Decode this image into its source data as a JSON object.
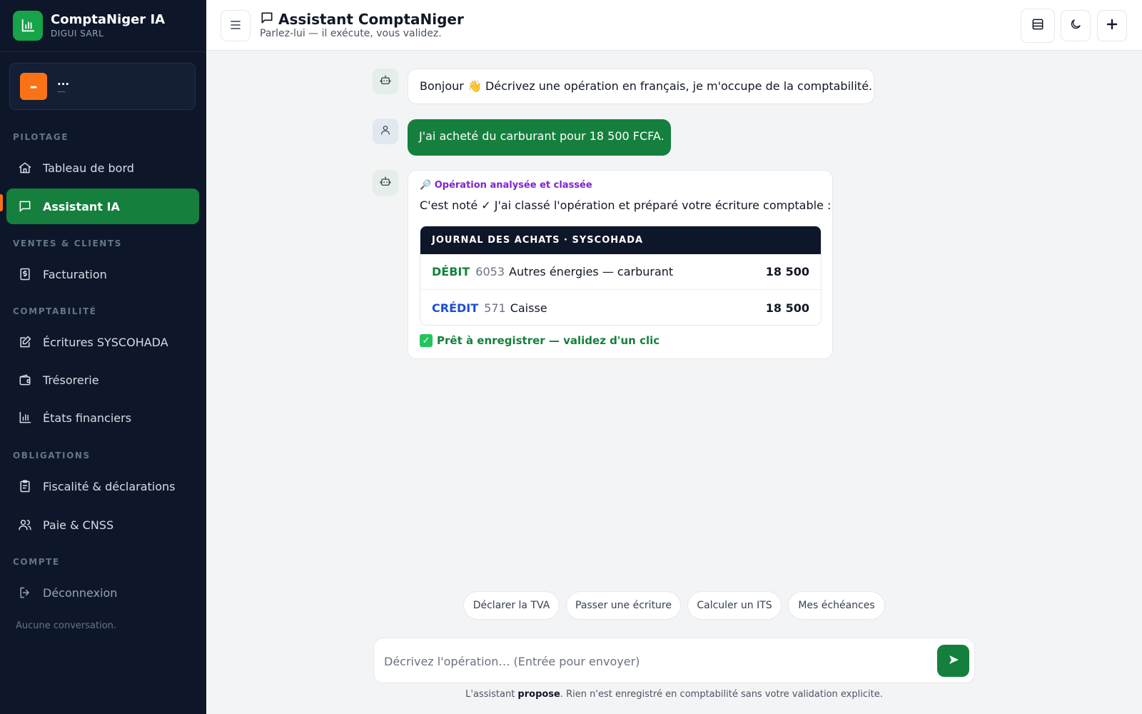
{
  "brand": {
    "name": "ComptaNiger IA",
    "company": "DIGUI SARL"
  },
  "company_card": {
    "avatar": "–",
    "name": "...",
    "plan": "—"
  },
  "sidebar": {
    "sections": {
      "pilotage": "PILOTAGE",
      "ventes": "VENTES & CLIENTS",
      "compta": "COMPTABILITÉ",
      "obligations": "OBLIGATIONS",
      "compte": "COMPTE"
    },
    "items": [
      {
        "label": "Tableau de bord",
        "icon": "home-icon"
      },
      {
        "label": "Assistant IA",
        "icon": "chat-icon",
        "active": true
      },
      {
        "label": "Facturation",
        "icon": "invoice-icon"
      },
      {
        "label": "Écritures SYSCOHADA",
        "icon": "edit-icon"
      },
      {
        "label": "Trésorerie",
        "icon": "wallet-icon"
      },
      {
        "label": "États financiers",
        "icon": "bar-chart-icon"
      },
      {
        "label": "Fiscalité & déclarations",
        "icon": "clipboard-icon"
      },
      {
        "label": "Paie & CNSS",
        "icon": "users-icon"
      },
      {
        "label": "Déconnexion",
        "icon": "logout-icon"
      }
    ],
    "empty_conversations": "Aucune conversation."
  },
  "header": {
    "title": "Assistant ComptaNiger",
    "subtitle": "Parlez-lui — il exécute, vous validez."
  },
  "chat": {
    "greeting": "Bonjour 👋 Décrivez une opération en français, je m'occupe de la comptabilité.",
    "user_message": "J'ai acheté du carburant pour 18 500 FCFA.",
    "analysis": {
      "tag": "🔎 Opération analysée et classée",
      "text": "C'est noté ✓ J'ai classé l'opération et préparé votre écriture comptable :",
      "journal_title": "JOURNAL DES ACHATS · SYSCOHADA",
      "rows": [
        {
          "type": "DÉBIT",
          "account": "6053",
          "label": "Autres énergies — carburant",
          "amount": "18 500"
        },
        {
          "type": "CRÉDIT",
          "account": "571",
          "label": "Caisse",
          "amount": "18 500"
        }
      ],
      "ready": "Prêt à enregistrer — validez d'un clic"
    }
  },
  "suggestions": [
    "Déclarer la TVA",
    "Passer une écriture",
    "Calculer un ITS",
    "Mes échéances"
  ],
  "composer": {
    "placeholder": "Décrivez l'opération… (Entrée pour envoyer)",
    "value": ""
  },
  "disclaimer": {
    "prefix": "L'assistant ",
    "emphasis": "propose",
    "suffix": ". Rien n'est enregistré en comptabilité sans votre validation explicite."
  },
  "colors": {
    "primary": "#15803d",
    "sidebar": "#0e1729",
    "accent": "#f97316",
    "credit": "#1d4ed8",
    "tag": "#7e22ce"
  }
}
